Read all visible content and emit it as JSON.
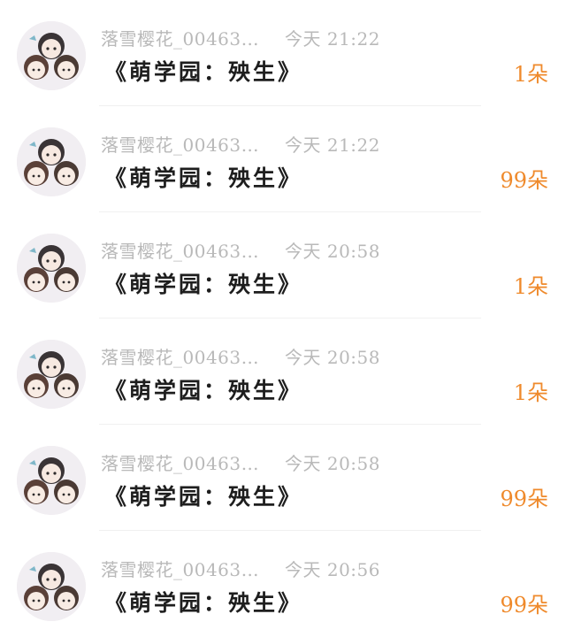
{
  "rows": [
    {
      "user": "落雪樱花_00463…",
      "time": "今天 21:22",
      "book": "《萌学园：殃生》",
      "amount": "1朵"
    },
    {
      "user": "落雪樱花_00463…",
      "time": "今天 21:22",
      "book": "《萌学园：殃生》",
      "amount": "99朵"
    },
    {
      "user": "落雪樱花_00463…",
      "time": "今天 20:58",
      "book": "《萌学园：殃生》",
      "amount": "1朵"
    },
    {
      "user": "落雪樱花_00463…",
      "time": "今天 20:58",
      "book": "《萌学园：殃生》",
      "amount": "1朵"
    },
    {
      "user": "落雪樱花_00463…",
      "time": "今天 20:58",
      "book": "《萌学园：殃生》",
      "amount": "99朵"
    },
    {
      "user": "落雪樱花_00463…",
      "time": "今天 20:56",
      "book": "《萌学园：殃生》",
      "amount": "99朵"
    }
  ],
  "colors": {
    "amount": "#ef8a2c",
    "meta": "#b9b9b9",
    "title": "#1e1e1e"
  }
}
